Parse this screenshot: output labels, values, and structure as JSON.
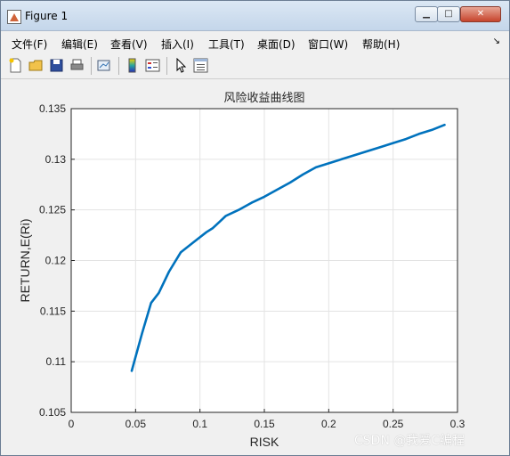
{
  "window": {
    "title": "Figure 1"
  },
  "menu": {
    "items": [
      "文件(F)",
      "编辑(E)",
      "查看(V)",
      "插入(I)",
      "工具(T)",
      "桌面(D)",
      "窗口(W)",
      "帮助(H)"
    ]
  },
  "toolbar": {
    "icons": [
      "new-figure-icon",
      "open-file-icon",
      "save-icon",
      "print-icon",
      "link-plot-icon",
      "colorbar-icon",
      "legend-icon",
      "pointer-icon",
      "property-editor-icon"
    ]
  },
  "chart_data": {
    "type": "line",
    "title": "风险收益曲线图",
    "xlabel": "RISK",
    "ylabel": "RETURN,E(Ri)",
    "xlim": [
      0,
      0.3
    ],
    "ylim": [
      0.105,
      0.135
    ],
    "xticks": [
      "0",
      "0.05",
      "0.1",
      "0.15",
      "0.2",
      "0.25",
      "0.3"
    ],
    "yticks": [
      "0.105",
      "0.11",
      "0.115",
      "0.12",
      "0.125",
      "0.13",
      "0.135"
    ],
    "grid": true,
    "color": "#0072bd",
    "x": [
      0.047,
      0.055,
      0.062,
      0.068,
      0.076,
      0.085,
      0.095,
      0.105,
      0.11,
      0.115,
      0.12,
      0.13,
      0.14,
      0.15,
      0.16,
      0.17,
      0.18,
      0.19,
      0.2,
      0.21,
      0.22,
      0.23,
      0.24,
      0.25,
      0.26,
      0.27,
      0.28,
      0.29
    ],
    "y": [
      0.1091,
      0.1128,
      0.1158,
      0.1168,
      0.1189,
      0.1208,
      0.1218,
      0.1228,
      0.1232,
      0.1238,
      0.1244,
      0.125,
      0.1257,
      0.1263,
      0.127,
      0.1277,
      0.1285,
      0.1292,
      0.1296,
      0.13,
      0.1304,
      0.1308,
      0.1312,
      0.1316,
      0.132,
      0.1325,
      0.1329,
      0.1334
    ]
  },
  "watermark": "CSDN @我爱C编程"
}
